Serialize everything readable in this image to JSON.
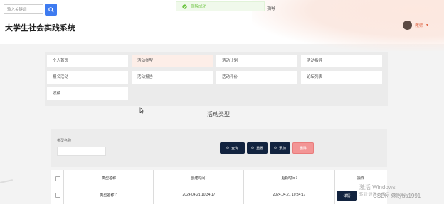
{
  "header": {
    "search_placeholder": "输入关键词",
    "site_title": "大学生社会实践系统",
    "user_name": "教师",
    "user_arrow": "▾"
  },
  "toast": {
    "message": "删除成功",
    "side_text": "指导"
  },
  "menu": {
    "items": [
      {
        "label": "个人首页",
        "active": false
      },
      {
        "label": "活动类型",
        "active": true
      },
      {
        "label": "活动计划",
        "active": false
      },
      {
        "label": "活动指导",
        "active": false
      },
      {
        "label": "报名活动",
        "active": false
      },
      {
        "label": "活动报告",
        "active": false
      },
      {
        "label": "活动评价",
        "active": false
      },
      {
        "label": "论坛列表",
        "active": false
      },
      {
        "label": "收藏",
        "active": false
      }
    ]
  },
  "section": {
    "title": "活动类型"
  },
  "filter": {
    "label": "类型名称",
    "value": "",
    "buttons": {
      "query": "查询",
      "reset": "重置",
      "add": "添加",
      "delete": "删除"
    }
  },
  "table": {
    "headers": [
      "类型名称",
      "创建时间",
      "更新时间",
      "操作"
    ],
    "sort_marks": [
      "",
      "↕",
      "↕",
      ""
    ],
    "rows": [
      {
        "name": "类型名称11",
        "created": "2024.04.21 10:34:17",
        "updated": "2024.04.21 10:34:17",
        "action": "详情"
      }
    ]
  },
  "watermark": {
    "line1": "激活 Windows",
    "line2": "转到\"设置\"以激活 Windows。",
    "csdn": "CSDN @kybs1991"
  },
  "colors": {
    "primary": "#3e7bf0",
    "dark_button": "#12233f",
    "danger": "#f39595",
    "active_menu": "#fdeee8",
    "toast_text": "#67c23a"
  }
}
